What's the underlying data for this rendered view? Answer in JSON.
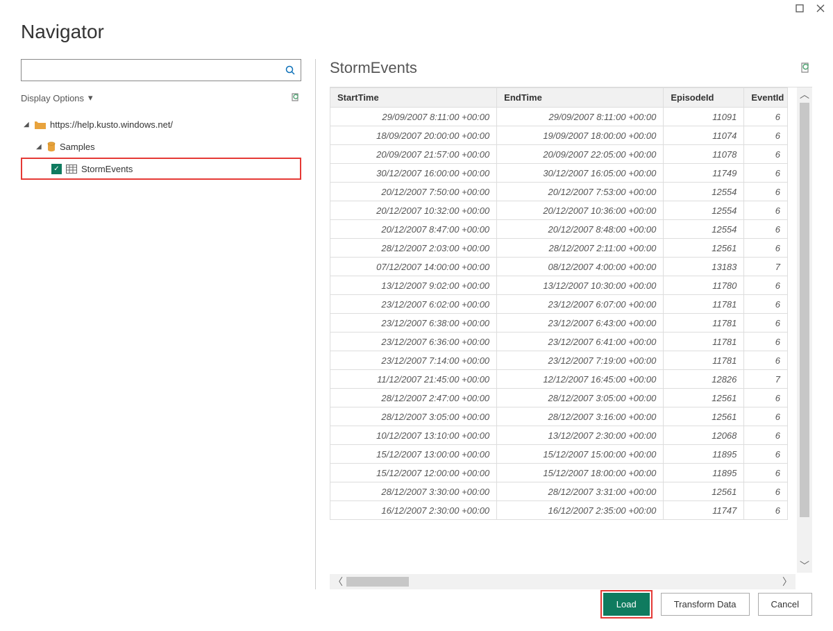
{
  "window": {
    "title": "Navigator"
  },
  "left": {
    "search_placeholder": "",
    "display_options_label": "Display Options",
    "tree": {
      "root_label": "https://help.kusto.windows.net/",
      "db_label": "Samples",
      "table_label": "StormEvents"
    }
  },
  "preview": {
    "title": "StormEvents",
    "columns": {
      "start": "StartTime",
      "end": "EndTime",
      "episode": "EpisodeId",
      "event": "EventId"
    },
    "rows": [
      {
        "start": "29/09/2007 8:11:00 +00:00",
        "end": "29/09/2007 8:11:00 +00:00",
        "ep": "11091",
        "ev": "6"
      },
      {
        "start": "18/09/2007 20:00:00 +00:00",
        "end": "19/09/2007 18:00:00 +00:00",
        "ep": "11074",
        "ev": "6"
      },
      {
        "start": "20/09/2007 21:57:00 +00:00",
        "end": "20/09/2007 22:05:00 +00:00",
        "ep": "11078",
        "ev": "6"
      },
      {
        "start": "30/12/2007 16:00:00 +00:00",
        "end": "30/12/2007 16:05:00 +00:00",
        "ep": "11749",
        "ev": "6"
      },
      {
        "start": "20/12/2007 7:50:00 +00:00",
        "end": "20/12/2007 7:53:00 +00:00",
        "ep": "12554",
        "ev": "6"
      },
      {
        "start": "20/12/2007 10:32:00 +00:00",
        "end": "20/12/2007 10:36:00 +00:00",
        "ep": "12554",
        "ev": "6"
      },
      {
        "start": "20/12/2007 8:47:00 +00:00",
        "end": "20/12/2007 8:48:00 +00:00",
        "ep": "12554",
        "ev": "6"
      },
      {
        "start": "28/12/2007 2:03:00 +00:00",
        "end": "28/12/2007 2:11:00 +00:00",
        "ep": "12561",
        "ev": "6"
      },
      {
        "start": "07/12/2007 14:00:00 +00:00",
        "end": "08/12/2007 4:00:00 +00:00",
        "ep": "13183",
        "ev": "7"
      },
      {
        "start": "13/12/2007 9:02:00 +00:00",
        "end": "13/12/2007 10:30:00 +00:00",
        "ep": "11780",
        "ev": "6"
      },
      {
        "start": "23/12/2007 6:02:00 +00:00",
        "end": "23/12/2007 6:07:00 +00:00",
        "ep": "11781",
        "ev": "6"
      },
      {
        "start": "23/12/2007 6:38:00 +00:00",
        "end": "23/12/2007 6:43:00 +00:00",
        "ep": "11781",
        "ev": "6"
      },
      {
        "start": "23/12/2007 6:36:00 +00:00",
        "end": "23/12/2007 6:41:00 +00:00",
        "ep": "11781",
        "ev": "6"
      },
      {
        "start": "23/12/2007 7:14:00 +00:00",
        "end": "23/12/2007 7:19:00 +00:00",
        "ep": "11781",
        "ev": "6"
      },
      {
        "start": "11/12/2007 21:45:00 +00:00",
        "end": "12/12/2007 16:45:00 +00:00",
        "ep": "12826",
        "ev": "7"
      },
      {
        "start": "28/12/2007 2:47:00 +00:00",
        "end": "28/12/2007 3:05:00 +00:00",
        "ep": "12561",
        "ev": "6"
      },
      {
        "start": "28/12/2007 3:05:00 +00:00",
        "end": "28/12/2007 3:16:00 +00:00",
        "ep": "12561",
        "ev": "6"
      },
      {
        "start": "10/12/2007 13:10:00 +00:00",
        "end": "13/12/2007 2:30:00 +00:00",
        "ep": "12068",
        "ev": "6"
      },
      {
        "start": "15/12/2007 13:00:00 +00:00",
        "end": "15/12/2007 15:00:00 +00:00",
        "ep": "11895",
        "ev": "6"
      },
      {
        "start": "15/12/2007 12:00:00 +00:00",
        "end": "15/12/2007 18:00:00 +00:00",
        "ep": "11895",
        "ev": "6"
      },
      {
        "start": "28/12/2007 3:30:00 +00:00",
        "end": "28/12/2007 3:31:00 +00:00",
        "ep": "12561",
        "ev": "6"
      },
      {
        "start": "16/12/2007 2:30:00 +00:00",
        "end": "16/12/2007 2:35:00 +00:00",
        "ep": "11747",
        "ev": "6"
      }
    ]
  },
  "footer": {
    "load": "Load",
    "transform": "Transform Data",
    "cancel": "Cancel"
  }
}
